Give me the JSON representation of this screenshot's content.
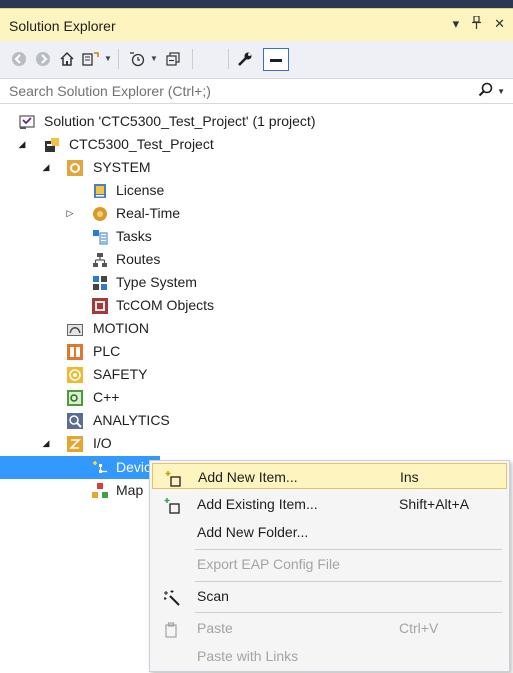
{
  "panel": {
    "title": "Solution Explorer",
    "dropdown_glyph": "▾",
    "pin_glyph": "📌",
    "close_glyph": "✕"
  },
  "search": {
    "placeholder": "Search Solution Explorer (Ctrl+;)"
  },
  "tree": {
    "solution": "Solution 'CTC5300_Test_Project' (1 project)",
    "project": "CTC5300_Test_Project",
    "system": "SYSTEM",
    "license": "License",
    "realtime": "Real-Time",
    "tasks": "Tasks",
    "routes": "Routes",
    "typesystem": "Type System",
    "tccom": "TcCOM Objects",
    "motion": "MOTION",
    "plc": "PLC",
    "safety": "SAFETY",
    "cpp": "C++",
    "analytics": "ANALYTICS",
    "io": "I/O",
    "devices": "Devic",
    "mappings": "Map"
  },
  "context_menu": {
    "add_new_item": {
      "label": "Add New Item...",
      "shortcut": "Ins"
    },
    "add_existing_item": {
      "label": "Add Existing Item...",
      "shortcut": "Shift+Alt+A"
    },
    "add_new_folder": {
      "label": "Add New Folder..."
    },
    "export_eap": {
      "label": "Export EAP Config File"
    },
    "scan": {
      "label": "Scan"
    },
    "paste": {
      "label": "Paste",
      "shortcut": "Ctrl+V"
    },
    "paste_links": {
      "label": "Paste with Links"
    }
  },
  "colors": {
    "title_bg": "#fdf4bf",
    "selection": "#3399ff",
    "menu_highlight": "#fdf4bf",
    "disabled_text": "#a2a4a5"
  }
}
